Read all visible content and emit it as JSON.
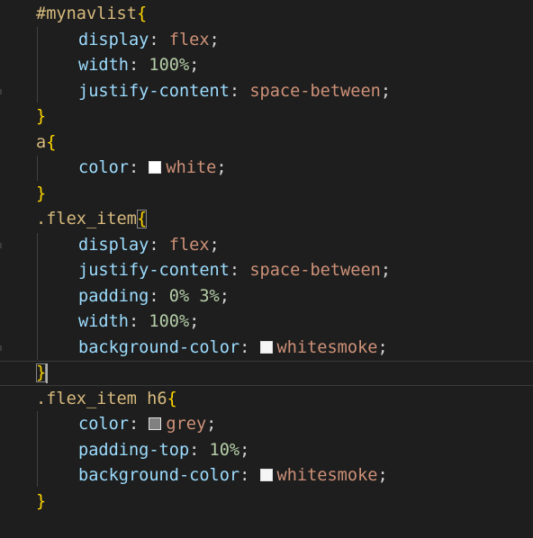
{
  "editor": {
    "language": "css",
    "colors": {
      "background": "#1e1e1e",
      "selector": "#d7ba7d",
      "brace": "#ffd700",
      "property": "#9cdcfe",
      "value": "#ce9178",
      "number": "#b5cea8"
    },
    "lines": [
      {
        "selector": "#mynavlist",
        "open": "{"
      },
      {
        "prop": "display",
        "value": "flex"
      },
      {
        "prop": "width",
        "value": "100%"
      },
      {
        "prop": "justify-content",
        "value": "space-between"
      },
      {
        "close": "}"
      },
      {
        "selector": "a",
        "open": "{"
      },
      {
        "prop": "color",
        "value": "white",
        "swatch": "#ffffff"
      },
      {
        "close": "}"
      },
      {
        "selector": ".flex_item",
        "open": "{"
      },
      {
        "prop": "display",
        "value": "flex"
      },
      {
        "prop": "justify-content",
        "value": "space-between"
      },
      {
        "prop": "padding",
        "value": "0% 3%"
      },
      {
        "prop": "width",
        "value": "100%"
      },
      {
        "prop": "background-color",
        "value": "whitesmoke",
        "swatch": "#f5f5f5"
      },
      {
        "close": "}"
      },
      {
        "selector": ".flex_item h6",
        "open": "{"
      },
      {
        "prop": "color",
        "value": "grey",
        "swatch": "#808080"
      },
      {
        "prop": "padding-top",
        "value": "10%"
      },
      {
        "prop": "background-color",
        "value": "whitesmoke",
        "swatch": "#f5f5f5"
      },
      {
        "close": "}"
      }
    ]
  }
}
